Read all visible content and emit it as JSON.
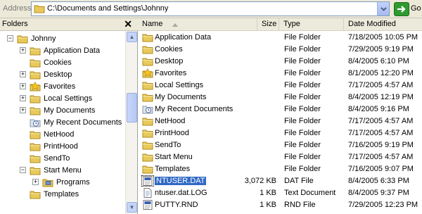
{
  "address": {
    "label": "Address",
    "path": "C:\\Documents and Settings\\Johnny",
    "go_label": "Go"
  },
  "folders_pane": {
    "title": "Folders",
    "close": "✕",
    "tree": [
      {
        "label": "Johnny",
        "icon": "folder-open-icon",
        "expander": "−",
        "depth": 0
      },
      {
        "label": "Application Data",
        "icon": "folder-icon",
        "expander": "+",
        "depth": 1
      },
      {
        "label": "Cookies",
        "icon": "folder-icon",
        "expander": "",
        "depth": 1
      },
      {
        "label": "Desktop",
        "icon": "folder-icon",
        "expander": "+",
        "depth": 1
      },
      {
        "label": "Favorites",
        "icon": "star-folder-icon",
        "expander": "+",
        "depth": 1
      },
      {
        "label": "Local Settings",
        "icon": "folder-icon",
        "expander": "+",
        "depth": 1
      },
      {
        "label": "My Documents",
        "icon": "folder-icon",
        "expander": "+",
        "depth": 1
      },
      {
        "label": "My Recent Documents",
        "icon": "recent-docs-icon",
        "expander": "",
        "depth": 1
      },
      {
        "label": "NetHood",
        "icon": "folder-icon",
        "expander": "",
        "depth": 1
      },
      {
        "label": "PrintHood",
        "icon": "folder-icon",
        "expander": "",
        "depth": 1
      },
      {
        "label": "SendTo",
        "icon": "folder-icon",
        "expander": "",
        "depth": 1
      },
      {
        "label": "Start Menu",
        "icon": "folder-icon",
        "expander": "−",
        "depth": 1
      },
      {
        "label": "Programs",
        "icon": "programs-icon",
        "expander": "+",
        "depth": 2
      },
      {
        "label": "Templates",
        "icon": "folder-icon",
        "expander": "",
        "depth": 1
      }
    ]
  },
  "columns": {
    "name": "Name",
    "size": "Size",
    "type": "Type",
    "date": "Date Modified"
  },
  "files": [
    {
      "name": "Application Data",
      "size": "",
      "type": "File Folder",
      "date": "7/18/2005 10:05 PM",
      "icon": "folder-icon"
    },
    {
      "name": "Cookies",
      "size": "",
      "type": "File Folder",
      "date": "7/29/2005 9:19 PM",
      "icon": "folder-icon"
    },
    {
      "name": "Desktop",
      "size": "",
      "type": "File Folder",
      "date": "8/4/2005 6:10 PM",
      "icon": "folder-icon"
    },
    {
      "name": "Favorites",
      "size": "",
      "type": "File Folder",
      "date": "8/1/2005 12:20 PM",
      "icon": "star-folder-icon"
    },
    {
      "name": "Local Settings",
      "size": "",
      "type": "File Folder",
      "date": "7/17/2005 4:57 AM",
      "icon": "folder-icon"
    },
    {
      "name": "My Documents",
      "size": "",
      "type": "File Folder",
      "date": "8/4/2005 12:19 PM",
      "icon": "folder-icon"
    },
    {
      "name": "My Recent Documents",
      "size": "",
      "type": "File Folder",
      "date": "8/4/2005 9:16 PM",
      "icon": "recent-docs-icon"
    },
    {
      "name": "NetHood",
      "size": "",
      "type": "File Folder",
      "date": "7/17/2005 4:57 AM",
      "icon": "folder-icon"
    },
    {
      "name": "PrintHood",
      "size": "",
      "type": "File Folder",
      "date": "7/17/2005 4:57 AM",
      "icon": "folder-icon"
    },
    {
      "name": "SendTo",
      "size": "",
      "type": "File Folder",
      "date": "7/16/2005 9:19 PM",
      "icon": "folder-icon"
    },
    {
      "name": "Start Menu",
      "size": "",
      "type": "File Folder",
      "date": "7/17/2005 4:57 AM",
      "icon": "folder-icon"
    },
    {
      "name": "Templates",
      "size": "",
      "type": "File Folder",
      "date": "7/16/2005 9:07 PM",
      "icon": "folder-icon"
    },
    {
      "name": "NTUSER.DAT",
      "size": "3,072 KB",
      "type": "DAT File",
      "date": "8/4/2005 6:33 PM",
      "icon": "dat-file-icon",
      "selected": true
    },
    {
      "name": "ntuser.dat.LOG",
      "size": "1 KB",
      "type": "Text Document",
      "date": "8/4/2005 9:37 PM",
      "icon": "text-file-icon"
    },
    {
      "name": "PUTTY.RND",
      "size": "1 KB",
      "type": "RND File",
      "date": "7/29/2005 12:23 PM",
      "icon": "rnd-file-icon"
    }
  ],
  "colors": {
    "folder": "#e8c95a",
    "selection": "#316ac5",
    "go_green": "#2f9a2f"
  }
}
